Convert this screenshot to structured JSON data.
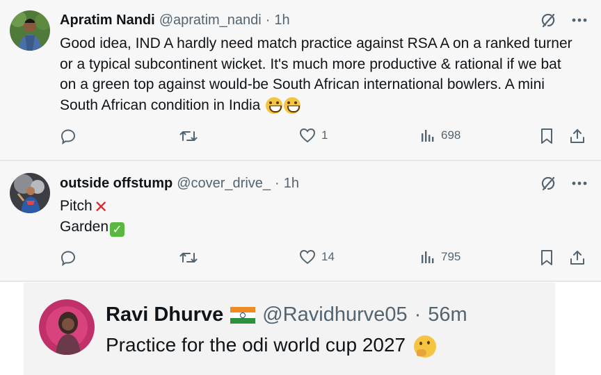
{
  "tweets": [
    {
      "name": "Apratim Nandi",
      "handle": "@apratim_nandi",
      "separator": "·",
      "time": "1h",
      "text": "Good idea, IND A hardly need match practice against RSA A on a ranked turner or a typical subcontinent wicket. It's much more productive & rational if we bat on a green top against would-be South African international bowlers. A mini South African condition in India",
      "emoji": "grinning-face-emoji",
      "reply_count": "",
      "retweet_count": "",
      "like_count": "1",
      "view_count": "698"
    },
    {
      "name": "outside offstump",
      "handle": "@cover_drive_",
      "separator": "·",
      "time": "1h",
      "line1": "Pitch",
      "line2": "Garden",
      "reply_count": "",
      "retweet_count": "",
      "like_count": "14",
      "view_count": "795"
    }
  ],
  "quoted": {
    "name": "Ravi Dhurve",
    "handle": "@Ravidhurve05",
    "separator": "·",
    "time": "56m",
    "text": "Practice for the odi world cup 2027",
    "flag": "india-flag",
    "emoji": "thinking-face-emoji"
  },
  "colors": {
    "text": "#0f1419",
    "muted": "#536471",
    "card_bg": "#f7f7f7",
    "check_green": "#58b83f",
    "cross_red": "#e0262b"
  }
}
